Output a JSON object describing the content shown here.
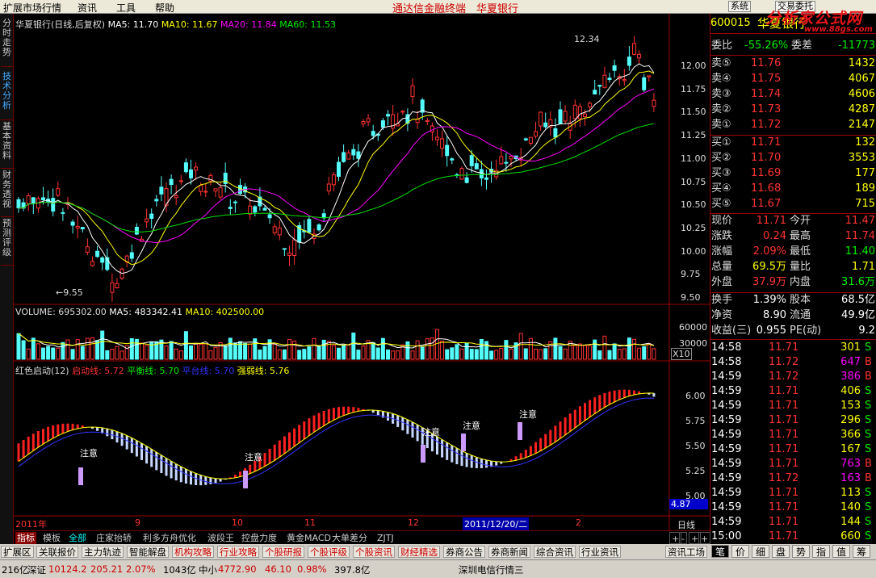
{
  "menu": {
    "items": [
      "扩展市场行情",
      "资讯",
      "工具",
      "帮助"
    ],
    "center_title": "通达信金融终端",
    "center_stock": "华夏银行",
    "btn_system": "系统",
    "btn_trade": "交易委托"
  },
  "logo": {
    "main": "分析家公式网",
    "url": "www.88gs.com"
  },
  "left_tabs": [
    "分时走势",
    "技术分析",
    "基本资料",
    "财务透视",
    "预测评级"
  ],
  "price_panel": {
    "title": "华夏银行(日线,后复权)",
    "ma5": "MA5: 11.70",
    "ma10": "MA10: 11.67",
    "ma20": "MA20: 11.84",
    "ma60": "MA60: 11.53",
    "high_label": "12.34",
    "low_label": "9.55",
    "yticks": [
      "12.00",
      "11.75",
      "11.50",
      "11.25",
      "11.00",
      "10.75",
      "10.50",
      "10.25",
      "10.00",
      "9.75",
      "9.50"
    ]
  },
  "volume_panel": {
    "legend": "VOLUME: 695302.00",
    "ma5": "MA5: 483342.41",
    "ma10": "MA10: 402500.00",
    "yticks": [
      "60000",
      "30000"
    ],
    "unit": "X10"
  },
  "indicator_panel": {
    "name": "红色启动(12)",
    "l1": "启动线: 5.72",
    "l2": "平衡线: 5.70",
    "l3": "平台线: 5.70",
    "l4": "强弱线: 5.76",
    "notes": [
      "注意",
      "注意",
      "注意",
      "注意",
      "注意"
    ],
    "yticks": [
      "6.00",
      "5.75",
      "5.50",
      "5.25",
      "5.00"
    ],
    "cursor_value": "4.87"
  },
  "x_axis": {
    "labels": [
      "2011年",
      "9",
      "10",
      "11",
      "12",
      "2011/12/20/二",
      "2"
    ],
    "period": "日线"
  },
  "quote": {
    "code": "600015",
    "name": "华夏银行",
    "wb_label": "委比",
    "wb": "-55.26%",
    "wc_label": "委差",
    "wc": "-11773",
    "sell": [
      {
        "l": "卖⑤",
        "p": "11.76",
        "v": "1432"
      },
      {
        "l": "卖④",
        "p": "11.75",
        "v": "4067"
      },
      {
        "l": "卖③",
        "p": "11.74",
        "v": "4606"
      },
      {
        "l": "卖②",
        "p": "11.73",
        "v": "4287"
      },
      {
        "l": "卖①",
        "p": "11.72",
        "v": "2147"
      }
    ],
    "buy": [
      {
        "l": "买①",
        "p": "11.71",
        "v": "132"
      },
      {
        "l": "买②",
        "p": "11.70",
        "v": "3553"
      },
      {
        "l": "买③",
        "p": "11.69",
        "v": "177"
      },
      {
        "l": "买④",
        "p": "11.68",
        "v": "189"
      },
      {
        "l": "买⑤",
        "p": "11.67",
        "v": "715"
      }
    ],
    "stats": [
      {
        "a": "现价",
        "av": "11.71",
        "b": "今开",
        "bv": "11.47"
      },
      {
        "a": "涨跌",
        "av": "0.24",
        "b": "最高",
        "bv": "11.74"
      },
      {
        "a": "涨幅",
        "av": "2.09%",
        "b": "最低",
        "bv": "11.40"
      },
      {
        "a": "总量",
        "av": "69.5万",
        "b": "量比",
        "bv": "1.71"
      },
      {
        "a": "外盘",
        "av": "37.9万",
        "b": "内盘",
        "bv": "31.6万"
      }
    ],
    "stats2": [
      {
        "a": "换手",
        "av": "1.39%",
        "b": "股本",
        "bv": "68.5亿"
      },
      {
        "a": "净资",
        "av": "8.90",
        "b": "流通",
        "bv": "49.9亿"
      },
      {
        "a": "收益(三)",
        "av": "0.955",
        "b": "PE(动)",
        "bv": "9.2"
      }
    ],
    "ticks": [
      {
        "t": "14:58",
        "p": "11.71",
        "v": "301",
        "s": "S"
      },
      {
        "t": "14:58",
        "p": "11.72",
        "v": "647",
        "s": "B"
      },
      {
        "t": "14:59",
        "p": "11.72",
        "v": "386",
        "s": "B"
      },
      {
        "t": "14:59",
        "p": "11.71",
        "v": "406",
        "s": "S"
      },
      {
        "t": "14:59",
        "p": "11.71",
        "v": "153",
        "s": "S"
      },
      {
        "t": "14:59",
        "p": "11.71",
        "v": "296",
        "s": "S"
      },
      {
        "t": "14:59",
        "p": "11.71",
        "v": "366",
        "s": "S"
      },
      {
        "t": "14:59",
        "p": "11.71",
        "v": "167",
        "s": "S"
      },
      {
        "t": "14:59",
        "p": "11.71",
        "v": "763",
        "s": "B"
      },
      {
        "t": "14:59",
        "p": "11.72",
        "v": "163",
        "s": "B"
      },
      {
        "t": "14:59",
        "p": "11.71",
        "v": "113",
        "s": "S"
      },
      {
        "t": "14:59",
        "p": "11.71",
        "v": "140",
        "s": "S"
      },
      {
        "t": "14:59",
        "p": "11.71",
        "v": "144",
        "s": "S"
      },
      {
        "t": "15:00",
        "p": "11.71",
        "v": "660",
        "s": "S"
      }
    ]
  },
  "bottom_tabs": [
    "指标",
    "模板",
    "全部",
    "庄家抬轿",
    "利多方舟优化",
    "波段王",
    "控盘力度",
    "黄金MACD",
    "大单差分",
    "ZJTJ"
  ],
  "bottom_right": [
    "+",
    "-",
    "+",
    "+"
  ],
  "link_bar": [
    "扩展区",
    "关联报价",
    "主力轨迹",
    "智能解盘",
    "机构攻略",
    "行业攻略",
    "个股研报",
    "个股评级",
    "个股资讯",
    "财经精选",
    "券商公告",
    "券商新闻",
    "综合资讯",
    "行业资讯",
    "资讯工场"
  ],
  "right_tabs": [
    "笔",
    "价",
    "细",
    "盘",
    "势",
    "指",
    "值",
    "筹"
  ],
  "status": {
    "a": "216亿",
    "b": "深证",
    "c": "10124.2",
    "d": "205.21",
    "e": "2.07%",
    "f": "1043亿",
    "g": "中小",
    "h": "4772.90",
    "i": "46.10",
    "j": "0.98%",
    "k": "397.8亿",
    "l": "深圳电信行情三"
  },
  "colors": {
    "up": "#ff3232",
    "down": "#54fcfc",
    "yellow": "#ffff00",
    "magenta": "#ff00ff",
    "green": "#00e000",
    "bg": "#000000"
  }
}
